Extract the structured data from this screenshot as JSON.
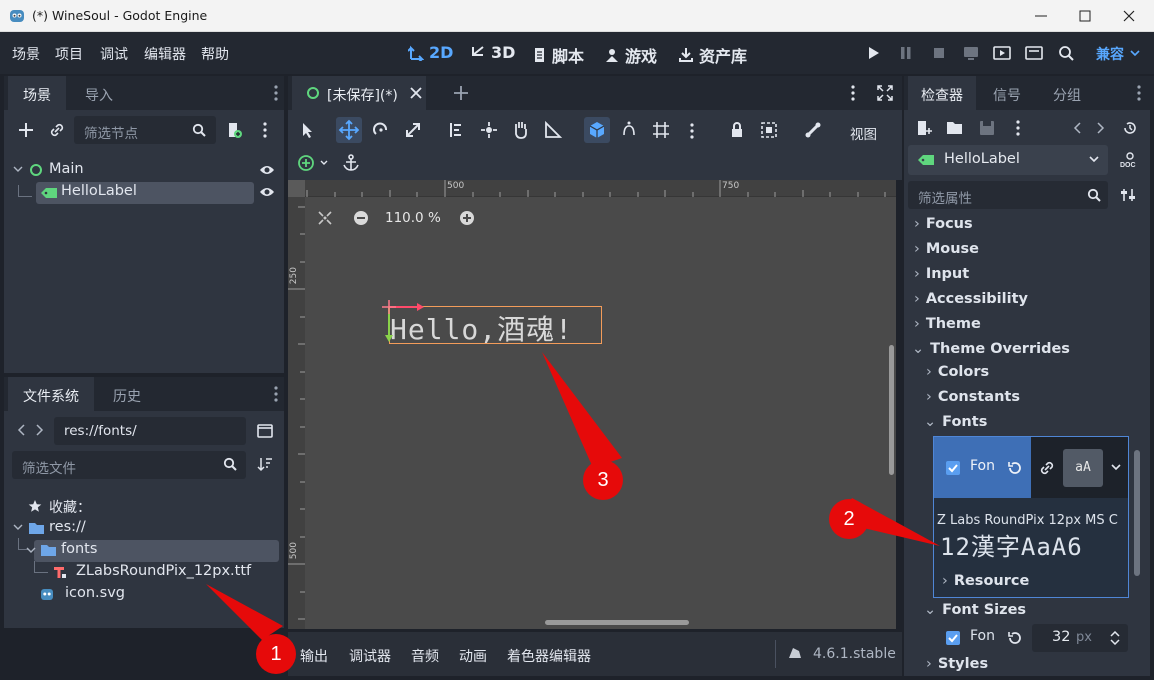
{
  "window": {
    "title": "(*) WineSoul - Godot Engine"
  },
  "menu": [
    "场景",
    "项目",
    "调试",
    "编辑器",
    "帮助"
  ],
  "workspaces": [
    {
      "label": "2D",
      "icon": "2d-icon",
      "active": true
    },
    {
      "label": "3D",
      "icon": "3d-icon",
      "active": false
    },
    {
      "label": "脚本",
      "icon": "script-icon",
      "active": false
    },
    {
      "label": "游戏",
      "icon": "game-icon",
      "active": false
    },
    {
      "label": "资产库",
      "icon": "asset-lib-icon",
      "active": false
    }
  ],
  "renderer": "兼容",
  "scene_dock": {
    "tabs": [
      "场景",
      "导入"
    ],
    "filter_placeholder": "筛选节点",
    "nodes": [
      {
        "name": "Main",
        "selected": false
      },
      {
        "name": "HelloLabel",
        "selected": true
      }
    ]
  },
  "fs_dock": {
    "tabs": [
      "文件系统",
      "历史"
    ],
    "path": "res://fonts/",
    "filter_placeholder": "筛选文件",
    "favorites_label": "收藏：",
    "items": [
      "res://",
      "fonts",
      "ZLabsRoundPix_12px.ttf",
      "icon.svg"
    ]
  },
  "editor_tab": {
    "label": "[未保存](*)"
  },
  "toolbar": {
    "view_label": "视图"
  },
  "viewport": {
    "zoom": "110.0 %",
    "ruler_h": [
      "500",
      "750"
    ],
    "ruler_v": [
      "250",
      "500"
    ],
    "label_text": "Hello,酒魂!"
  },
  "bottom_panel": {
    "tabs": [
      "输出",
      "调试器",
      "音频",
      "动画",
      "着色器编辑器"
    ],
    "version": "4.6.1.stable"
  },
  "inspector": {
    "tabs": [
      "检查器",
      "信号",
      "分组"
    ],
    "node_name": "HelloLabel",
    "filter_placeholder": "筛选属性",
    "sections": [
      "Focus",
      "Mouse",
      "Input",
      "Accessibility",
      "Theme",
      "Theme Overrides"
    ],
    "sub_sections": [
      "Colors",
      "Constants",
      "Fonts"
    ],
    "font_prop_label": "Fon",
    "font_preview_title": "Z Labs RoundPix 12px MS C",
    "font_preview_sample": "12漢字AaA6",
    "resource_label": "Resource",
    "font_sizes_label": "Font Sizes",
    "font_size_value": "32",
    "font_size_unit": "px",
    "styles_label": "Styles"
  },
  "callouts": [
    "1",
    "2",
    "3"
  ]
}
